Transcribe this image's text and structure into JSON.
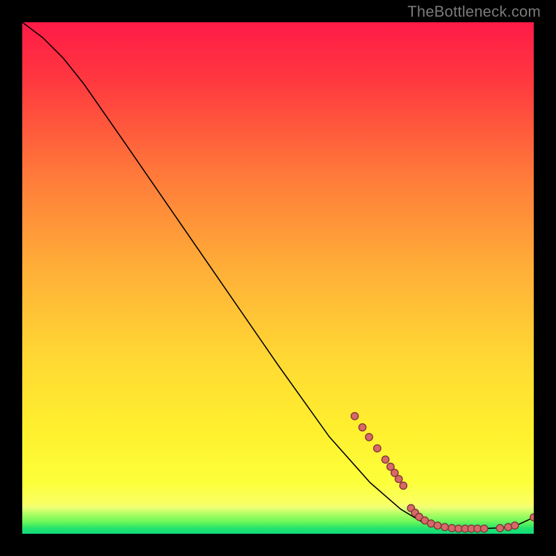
{
  "chart_data": {
    "type": "line",
    "watermark": "TheBottleneck.com",
    "title": "",
    "xlabel": "",
    "ylabel": "",
    "xlim": [
      0,
      100
    ],
    "ylim": [
      0,
      100
    ],
    "curve": [
      {
        "x": 0,
        "y": 100
      },
      {
        "x": 4,
        "y": 97
      },
      {
        "x": 8,
        "y": 93
      },
      {
        "x": 12,
        "y": 88
      },
      {
        "x": 20,
        "y": 76.5
      },
      {
        "x": 30,
        "y": 62
      },
      {
        "x": 40,
        "y": 47.5
      },
      {
        "x": 50,
        "y": 33
      },
      {
        "x": 60,
        "y": 19
      },
      {
        "x": 68,
        "y": 10
      },
      {
        "x": 74,
        "y": 4.8
      },
      {
        "x": 78,
        "y": 2.4
      },
      {
        "x": 82,
        "y": 1.3
      },
      {
        "x": 86,
        "y": 1.0
      },
      {
        "x": 90,
        "y": 1.0
      },
      {
        "x": 94,
        "y": 1.2
      },
      {
        "x": 97,
        "y": 1.8
      },
      {
        "x": 100,
        "y": 3.2
      }
    ],
    "markers": [
      {
        "x": 65.0,
        "y": 23.0
      },
      {
        "x": 66.5,
        "y": 20.8
      },
      {
        "x": 67.8,
        "y": 18.9
      },
      {
        "x": 69.4,
        "y": 16.7
      },
      {
        "x": 71.0,
        "y": 14.5
      },
      {
        "x": 72.0,
        "y": 13.1
      },
      {
        "x": 72.8,
        "y": 11.9
      },
      {
        "x": 73.6,
        "y": 10.7
      },
      {
        "x": 74.5,
        "y": 9.4
      },
      {
        "x": 76.0,
        "y": 5.0
      },
      {
        "x": 76.8,
        "y": 4.1
      },
      {
        "x": 77.6,
        "y": 3.3
      },
      {
        "x": 78.7,
        "y": 2.6
      },
      {
        "x": 79.9,
        "y": 2.0
      },
      {
        "x": 81.2,
        "y": 1.6
      },
      {
        "x": 82.6,
        "y": 1.3
      },
      {
        "x": 84.0,
        "y": 1.1
      },
      {
        "x": 85.3,
        "y": 1.0
      },
      {
        "x": 86.6,
        "y": 1.0
      },
      {
        "x": 87.8,
        "y": 1.0
      },
      {
        "x": 89.0,
        "y": 1.0
      },
      {
        "x": 90.3,
        "y": 1.0
      },
      {
        "x": 93.4,
        "y": 1.1
      },
      {
        "x": 95.0,
        "y": 1.3
      },
      {
        "x": 96.3,
        "y": 1.6
      },
      {
        "x": 100.0,
        "y": 3.2
      }
    ],
    "marker_radius": 5.2
  }
}
